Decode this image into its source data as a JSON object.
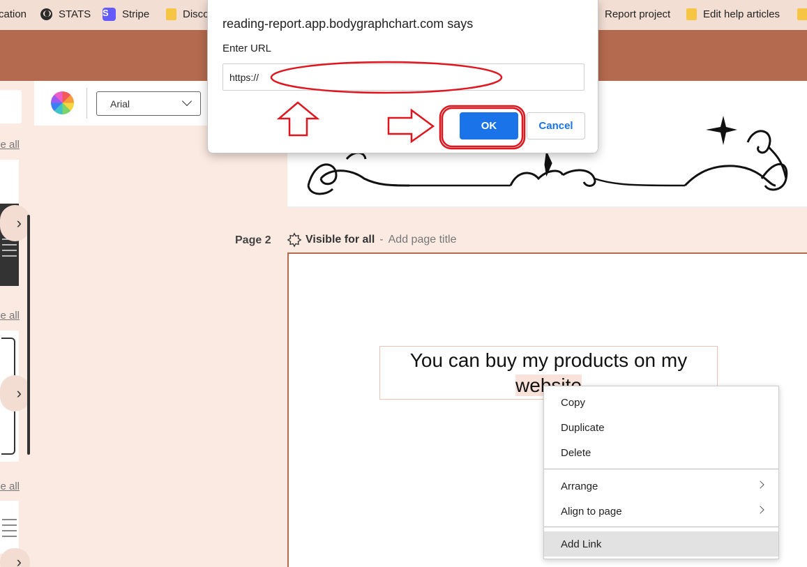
{
  "bookmarks": [
    {
      "label": "cation",
      "icon": "none"
    },
    {
      "label": "STATS",
      "icon": "globe-icon"
    },
    {
      "label": "Stripe",
      "icon": "stripe-icon"
    },
    {
      "label": "Disco",
      "icon": "folder-icon"
    },
    {
      "label": "Report project",
      "icon": "none"
    },
    {
      "label": "Edit help articles",
      "icon": "folder-icon"
    }
  ],
  "left_panel": {
    "see_all_label": "See all"
  },
  "toolbar": {
    "font_family_value": "Arial"
  },
  "page2": {
    "label": "Page 2",
    "visibility": "Visible for all",
    "separator": "-",
    "add_title_placeholder": "Add page title",
    "text_before": "You can buy my products on my ",
    "text_selected": "website"
  },
  "context_menu": {
    "items": [
      "Copy",
      "Duplicate",
      "Delete",
      "Arrange",
      "Align to page",
      "Add Link"
    ]
  },
  "dialog": {
    "title": "reading-report.app.bodygraphchart.com says",
    "label": "Enter URL",
    "input_value": "https://",
    "ok_label": "OK",
    "cancel_label": "Cancel"
  },
  "colors": {
    "header_bar": "#b46a4e",
    "canvas_bg": "#fbeae2",
    "ok_button": "#1a73e8",
    "annotation_red": "#e0161f"
  }
}
